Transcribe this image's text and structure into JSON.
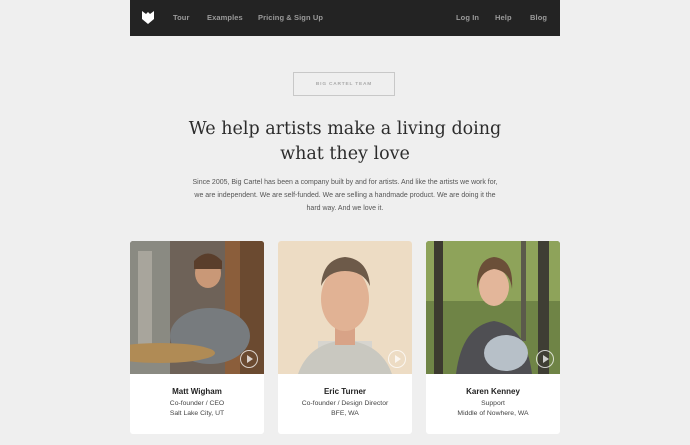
{
  "nav": {
    "logo_icon": "big-cartel-logo-icon",
    "left": [
      "Tour",
      "Examples",
      "Pricing & Sign Up"
    ],
    "right": [
      "Log In",
      "Help",
      "Blog"
    ]
  },
  "hero": {
    "label": "BIG CARTEL TEAM",
    "headline_line1": "We help artists make a living doing",
    "headline_line2": "what they love",
    "intro_line1": "Since 2005, Big Cartel has been a company built by and for artists. And like the artists we work for,",
    "intro_line2": "we are independent. We are self-funded. We are selling a handmade product. We are doing it the",
    "intro_line3": "hard way. And we love it."
  },
  "team": [
    {
      "name": "Matt Wigham",
      "role": "Co-founder / CEO",
      "location": "Salt Lake City, UT",
      "play_icon": "play-icon"
    },
    {
      "name": "Eric Turner",
      "role": "Co-founder / Design Director",
      "location": "BFE, WA",
      "play_icon": "play-icon"
    },
    {
      "name": "Karen Kenney",
      "role": "Support",
      "location": "Middle of Nowhere, WA",
      "play_icon": "play-icon"
    }
  ],
  "colors": {
    "topbar": "#232323",
    "background": "#efefef",
    "nav_text": "#9a9a9a",
    "card": "#ffffff"
  }
}
